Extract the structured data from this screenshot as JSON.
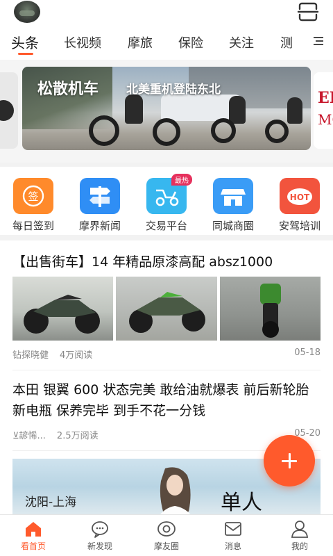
{
  "header": {
    "avatar": "user-avatar",
    "scan_icon": "scan-icon"
  },
  "tabs": [
    {
      "label": "头条",
      "active": true
    },
    {
      "label": "长视频"
    },
    {
      "label": "摩旅"
    },
    {
      "label": "保险"
    },
    {
      "label": "关注"
    },
    {
      "label": "测"
    }
  ],
  "banner": {
    "title": "松散机车",
    "subtitle": "北美重机登陆东北",
    "right_card_text_1": "ER",
    "right_card_text_2": "MO"
  },
  "quick_links": [
    {
      "label": "每日签到",
      "icon": "sign-in-icon",
      "color": "#ff8a2b",
      "glyph": "签"
    },
    {
      "label": "摩界新闻",
      "icon": "signpost-icon",
      "color": "#2f8ef5"
    },
    {
      "label": "交易平台",
      "icon": "scooter-icon",
      "color": "#37b7ef",
      "badge": "最热"
    },
    {
      "label": "同城商圈",
      "icon": "store-icon",
      "color": "#3a9cf6"
    },
    {
      "label": "安驾培训",
      "icon": "hot-icon",
      "color": "#f2543d",
      "glyph": "HOT"
    }
  ],
  "articles": [
    {
      "title": "【出售街车】14 年精品原漆高配 absz1000",
      "author": "钻探晓健",
      "views": "4万阅读",
      "date": "05-18"
    },
    {
      "title": "本田 银翼 600 状态完美 敢给油就爆表 前后新轮胎 新电瓶 保养完毕 到手不花一分钱",
      "author": "⊻諺悕...",
      "views": "2.5万阅读",
      "date": "05-20"
    },
    {
      "image_text_1": "沈阳-上海",
      "image_text_2": "单人"
    }
  ],
  "bottom_nav": [
    {
      "label": "看首页",
      "icon": "home-icon",
      "active": true
    },
    {
      "label": "新发现",
      "icon": "discover-icon"
    },
    {
      "label": "摩友圈",
      "icon": "circle-icon"
    },
    {
      "label": "消息",
      "icon": "message-icon"
    },
    {
      "label": "我的",
      "icon": "profile-icon"
    }
  ],
  "colors": {
    "accent": "#ff5a2c",
    "badge": "#e6315d"
  }
}
